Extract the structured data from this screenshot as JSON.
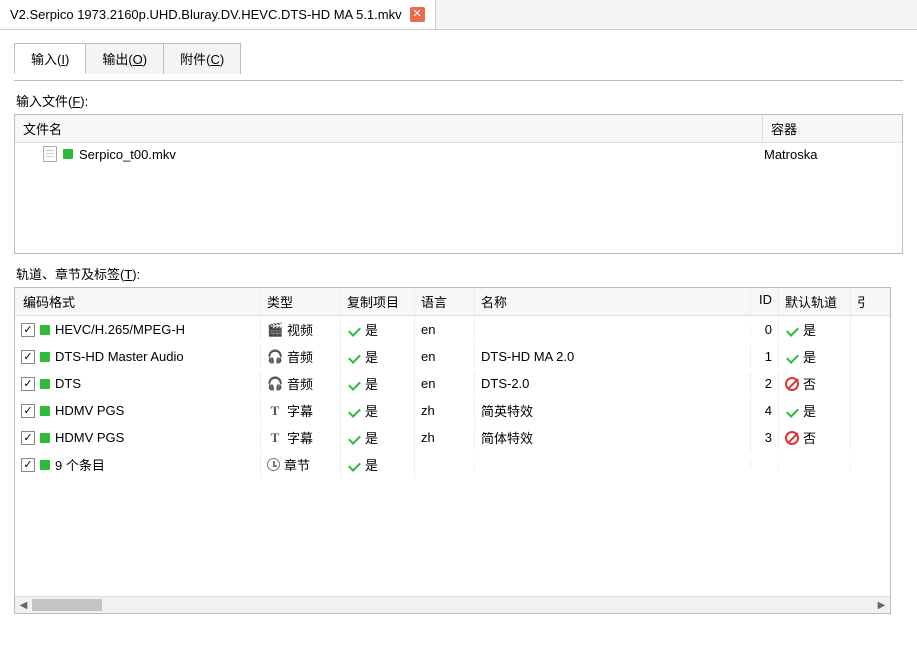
{
  "fileTab": {
    "title": "V2.Serpico 1973.2160p.UHD.Bluray.DV.HEVC.DTS-HD MA 5.1.mkv"
  },
  "innerTabs": {
    "input": {
      "pre": "输入(",
      "u": "I",
      "post": ")"
    },
    "output": {
      "pre": "输出(",
      "u": "O",
      "post": ")"
    },
    "attach": {
      "pre": "附件(",
      "u": "C",
      "post": ")"
    }
  },
  "labels": {
    "inputFiles": {
      "pre": "输入文件(",
      "u": "F",
      "post": "):"
    },
    "tracks": {
      "pre": "轨道、章节及标签(",
      "u": "T",
      "post": "):"
    }
  },
  "filesHeader": {
    "name": "文件名",
    "container": "容器"
  },
  "files": [
    {
      "name": "Serpico_t00.mkv",
      "container": "Matroska"
    }
  ],
  "tracksHeader": {
    "codec": "编码格式",
    "type": "类型",
    "copy": "复制项目",
    "lang": "语言",
    "name": "名称",
    "id": "ID",
    "def": "默认轨道",
    "x": "引"
  },
  "tracks": [
    {
      "checked": true,
      "codec": "HEVC/H.265/MPEG-H",
      "typeIcon": "video",
      "type": "视频",
      "copy": "是",
      "lang": "en",
      "name": "",
      "id": "0",
      "def": "yes",
      "defText": "是"
    },
    {
      "checked": true,
      "codec": "DTS-HD Master Audio",
      "typeIcon": "audio",
      "type": "音频",
      "copy": "是",
      "lang": "en",
      "name": "DTS-HD MA 2.0",
      "id": "1",
      "def": "yes",
      "defText": "是"
    },
    {
      "checked": true,
      "codec": "DTS",
      "typeIcon": "audio",
      "type": "音频",
      "copy": "是",
      "lang": "en",
      "name": "DTS-2.0",
      "id": "2",
      "def": "no",
      "defText": "否"
    },
    {
      "checked": true,
      "codec": "HDMV PGS",
      "typeIcon": "sub",
      "type": "字幕",
      "copy": "是",
      "lang": "zh",
      "name": "简英特效",
      "id": "4",
      "def": "yes",
      "defText": "是"
    },
    {
      "checked": true,
      "codec": "HDMV PGS",
      "typeIcon": "sub",
      "type": "字幕",
      "copy": "是",
      "lang": "zh",
      "name": "简体特效",
      "id": "3",
      "def": "no",
      "defText": "否"
    },
    {
      "checked": true,
      "codec": "9 个条目",
      "typeIcon": "chap",
      "type": "章节",
      "copy": "是",
      "lang": "",
      "name": "",
      "id": "",
      "def": "",
      "defText": ""
    }
  ]
}
